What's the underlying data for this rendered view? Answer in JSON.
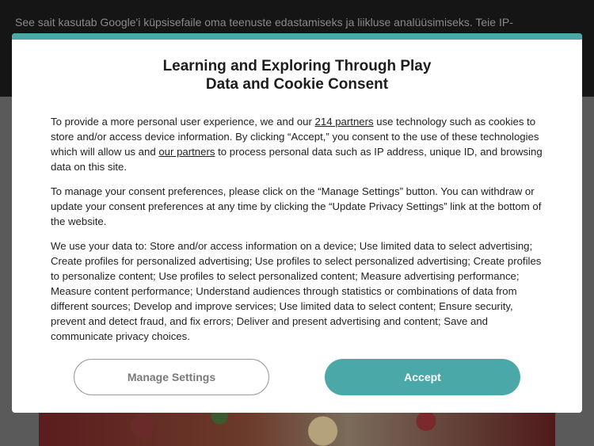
{
  "background": {
    "banner_text": "See sait kasutab Google'i küpsisefaile oma teenuste edastamiseks ja liikluse analüüsimiseks. Teie IP-"
  },
  "modal": {
    "title_line1": "Learning and Exploring Through Play",
    "title_line2": "Data and Cookie Consent",
    "p1": {
      "before_link1": "To provide a more personal user experience, we and our ",
      "link1": "214 partners",
      "between_links": " use technology such as cookies to store and/or access device information. By clicking “Accept,” you consent to the use of these technologies which will allow us and ",
      "link2": "our partners",
      "after_link2": " to process personal data such as IP address, unique ID, and browsing data on this site."
    },
    "p2": "To manage your consent preferences, please click on the “Manage Settings” button. You can withdraw or update your consent preferences at any time by clicking the “Update Privacy Settings” link at the bottom of the website.",
    "p3": "We use your data to: Store and/or access information on a device; Use limited data to select advertising; Create profiles for personalized advertising; Use profiles to select personalized advertising; Create profiles to personalize content; Use profiles to select personalized content; Measure advertising performance; Measure content performance; Understand audiences through statistics or combinations of data from different sources; Develop and improve services; Use limited data to select content; Ensure security, prevent and detect fraud, and fix errors; Deliver and present advertising and content; Save and communicate privacy choices.",
    "manage_label": "Manage Settings",
    "accept_label": "Accept"
  },
  "colors": {
    "accent": "#4aa8a8",
    "overlay": "#4a4a4a"
  }
}
